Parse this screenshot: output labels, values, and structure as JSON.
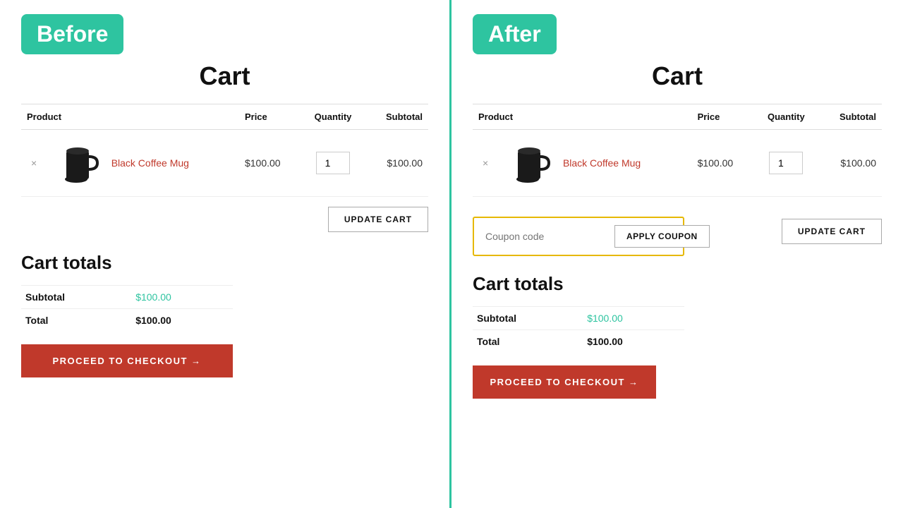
{
  "before": {
    "badge": "Before",
    "cart_title": "Cart",
    "table": {
      "headers": [
        "Product",
        "Price",
        "Quantity",
        "Subtotal"
      ],
      "row": {
        "product_name": "Black Coffee Mug",
        "price": "$100.00",
        "quantity": "1",
        "subtotal": "$100.00"
      }
    },
    "update_cart_btn": "UPDATE CART",
    "cart_totals_title": "Cart totals",
    "subtotal_label": "Subtotal",
    "subtotal_value": "$100.00",
    "total_label": "Total",
    "total_value": "$100.00",
    "checkout_btn": "PROCEED TO CHECKOUT →"
  },
  "after": {
    "badge": "After",
    "cart_title": "Cart",
    "table": {
      "headers": [
        "Product",
        "Price",
        "Quantity",
        "Subtotal"
      ],
      "row": {
        "product_name": "Black Coffee Mug",
        "price": "$100.00",
        "quantity": "1",
        "subtotal": "$100.00"
      }
    },
    "coupon_placeholder": "Coupon code",
    "apply_coupon_btn": "APPLY COUPON",
    "update_cart_btn": "UPDATE CART",
    "cart_totals_title": "Cart totals",
    "subtotal_label": "Subtotal",
    "subtotal_value": "$100.00",
    "total_label": "Total",
    "total_value": "$100.00",
    "checkout_btn": "PROCEED TO CHECKOUT →"
  },
  "divider_color": "#2ec4a0",
  "badge_color": "#2ec4a0",
  "link_color": "#c0392b",
  "checkout_bg": "#c0392b"
}
